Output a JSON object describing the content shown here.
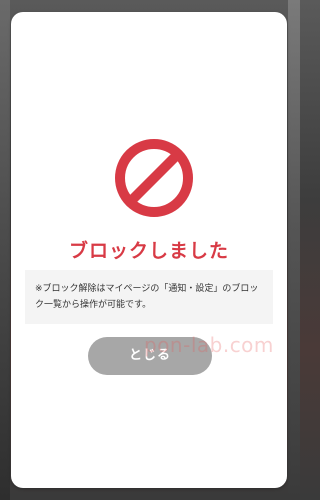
{
  "dialog": {
    "title": "ブロックしました",
    "note": "※ブロック解除はマイページの「通知・設定」のブロック一覧から操作が可能です。",
    "close_label": "とじる"
  },
  "watermark": {
    "text": "pon-lab.com"
  },
  "colors": {
    "accent": "#d83a45",
    "button": "#a7a7a7",
    "note_bg": "#f4f4f4"
  },
  "icons": {
    "status": "prohibited-icon"
  }
}
